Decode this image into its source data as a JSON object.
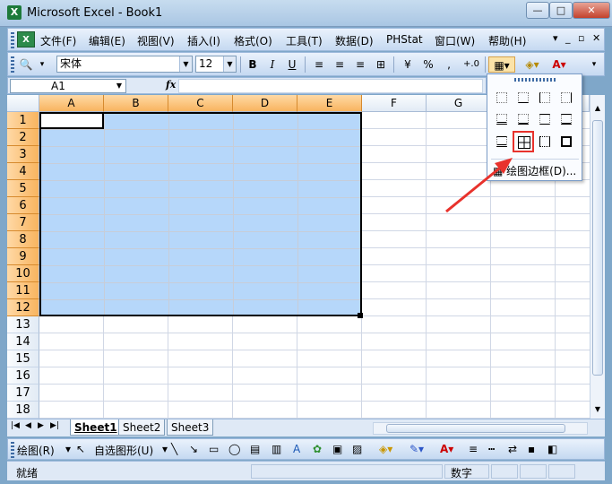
{
  "window": {
    "title": "Microsoft Excel - Book1",
    "min_glyph": "—",
    "max_glyph": "□",
    "close_glyph": "✕"
  },
  "menubar": {
    "items": [
      "文件(F)",
      "编辑(E)",
      "视图(V)",
      "插入(I)",
      "格式(O)",
      "工具(T)",
      "数据(D)",
      "PHStat",
      "窗口(W)",
      "帮助(H)"
    ],
    "controls": [
      "▾",
      "_",
      "▫",
      "✕"
    ]
  },
  "format_toolbar": {
    "font_name": "宋体",
    "font_size": "12",
    "bold": "B",
    "italic": "I",
    "underline": "U",
    "percent": "%",
    "comma": ",",
    "decimal": "+.0"
  },
  "namebox": {
    "value": "A1",
    "fx": "fx"
  },
  "columns": [
    "A",
    "B",
    "C",
    "D",
    "E",
    "F",
    "G"
  ],
  "rows": [
    "1",
    "2",
    "3",
    "4",
    "5",
    "6",
    "7",
    "8",
    "9",
    "10",
    "11",
    "12",
    "13",
    "14",
    "15",
    "16",
    "17",
    "18"
  ],
  "sheet_tabs": [
    "Sheet1",
    "Sheet2",
    "Sheet3"
  ],
  "draw_toolbar": {
    "draw_label": "绘图(R)",
    "autoshape_label": "自选图形(U)"
  },
  "statusbar": {
    "status": "就绪",
    "mode": "数字"
  },
  "borders_popup": {
    "draw_borders_label": "绘图边框(D)..."
  },
  "colors": {
    "selection": "#b6d7fa",
    "header_selected": "#f8b45f",
    "highlight": "#e8322c"
  }
}
